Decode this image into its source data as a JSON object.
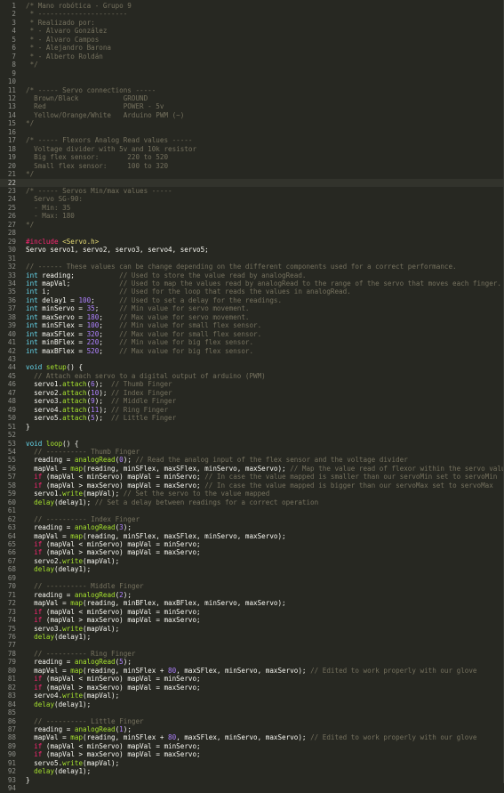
{
  "editor": {
    "current_line": 22,
    "lines": [
      [
        [
          "c",
          "/* Mano robótica - Grupo 9"
        ]
      ],
      [
        [
          "c",
          " * ----------------------"
        ]
      ],
      [
        [
          "c",
          " * Realizado por:"
        ]
      ],
      [
        [
          "c",
          " * - Álvaro González"
        ]
      ],
      [
        [
          "c",
          " * - Álvaro Campos"
        ]
      ],
      [
        [
          "c",
          " * - Alejandro Barona"
        ]
      ],
      [
        [
          "c",
          " * - Alberto Roldán"
        ]
      ],
      [
        [
          "c",
          " */"
        ]
      ],
      [],
      [],
      [
        [
          "c",
          "/* ----- Servo connections -----"
        ]
      ],
      [
        [
          "c",
          "  Brown/Black           GROUND"
        ]
      ],
      [
        [
          "c",
          "  Red                   POWER - 5v"
        ]
      ],
      [
        [
          "c",
          "  Yellow/Orange/White   Arduino PWM (~)"
        ]
      ],
      [
        [
          "c",
          "*/"
        ]
      ],
      [],
      [
        [
          "c",
          "/* ----- Flexors Analog Read values -----"
        ]
      ],
      [
        [
          "c",
          "  Voltage divider with 5v and 10k resistor"
        ]
      ],
      [
        [
          "c",
          "  Big flex sensor:       220 to 520"
        ]
      ],
      [
        [
          "c",
          "  Small flex sensor:     100 to 320"
        ]
      ],
      [
        [
          "c",
          "*/"
        ]
      ],
      [],
      [
        [
          "c",
          "/* ----- Servos Min/max values -----"
        ]
      ],
      [
        [
          "c",
          "  Servo SG-90:"
        ]
      ],
      [
        [
          "c",
          "  - Min: 35"
        ]
      ],
      [
        [
          "c",
          "  - Max: 180"
        ]
      ],
      [
        [
          "c",
          "*/"
        ]
      ],
      [],
      [
        [
          "k",
          "#include "
        ],
        [
          "s",
          "<Servo.h>"
        ]
      ],
      [
        [
          "p",
          "Servo servo1, servo2, servo3, servo4, servo5;"
        ]
      ],
      [],
      [
        [
          "c",
          "// ------ These values can be change depending on the different components used for a correct performance."
        ]
      ],
      [
        [
          "t",
          "int"
        ],
        [
          "p",
          " reading;           "
        ],
        [
          "c",
          "// Used to store the value read by analogRead."
        ]
      ],
      [
        [
          "t",
          "int"
        ],
        [
          "p",
          " mapVal;            "
        ],
        [
          "c",
          "// Used to map the values read by analogRead to the range of the servo that moves each finger."
        ]
      ],
      [
        [
          "t",
          "int"
        ],
        [
          "p",
          " i;                 "
        ],
        [
          "c",
          "// Used for the loop that reads the values in analogRead."
        ]
      ],
      [
        [
          "t",
          "int"
        ],
        [
          "p",
          " delay1 = "
        ],
        [
          "n",
          "100"
        ],
        [
          "p",
          ";      "
        ],
        [
          "c",
          "// Used to set a delay for the readings."
        ]
      ],
      [
        [
          "t",
          "int"
        ],
        [
          "p",
          " minServo = "
        ],
        [
          "n",
          "35"
        ],
        [
          "p",
          ";     "
        ],
        [
          "c",
          "// Min value for servo movement."
        ]
      ],
      [
        [
          "t",
          "int"
        ],
        [
          "p",
          " maxServo = "
        ],
        [
          "n",
          "180"
        ],
        [
          "p",
          ";    "
        ],
        [
          "c",
          "// Max value for servo movement."
        ]
      ],
      [
        [
          "t",
          "int"
        ],
        [
          "p",
          " minSFlex = "
        ],
        [
          "n",
          "100"
        ],
        [
          "p",
          ";    "
        ],
        [
          "c",
          "// Min value for small flex sensor."
        ]
      ],
      [
        [
          "t",
          "int"
        ],
        [
          "p",
          " maxSFlex = "
        ],
        [
          "n",
          "320"
        ],
        [
          "p",
          ";    "
        ],
        [
          "c",
          "// Max value for small flex sensor."
        ]
      ],
      [
        [
          "t",
          "int"
        ],
        [
          "p",
          " minBFlex = "
        ],
        [
          "n",
          "220"
        ],
        [
          "p",
          ";    "
        ],
        [
          "c",
          "// Min value for big flex sensor."
        ]
      ],
      [
        [
          "t",
          "int"
        ],
        [
          "p",
          " maxBFlex = "
        ],
        [
          "n",
          "520"
        ],
        [
          "p",
          ";    "
        ],
        [
          "c",
          "// Max value for big flex sensor."
        ]
      ],
      [],
      [
        [
          "t",
          "void"
        ],
        [
          "p",
          " "
        ],
        [
          "f",
          "setup"
        ],
        [
          "p",
          "() {"
        ]
      ],
      [
        [
          "c",
          "  // Attach each servo to a digital output of arduino (PWM)"
        ]
      ],
      [
        [
          "p",
          "  servo1."
        ],
        [
          "f",
          "attach"
        ],
        [
          "p",
          "("
        ],
        [
          "n",
          "6"
        ],
        [
          "p",
          ");  "
        ],
        [
          "c",
          "// Thumb Finger"
        ]
      ],
      [
        [
          "p",
          "  servo2."
        ],
        [
          "f",
          "attach"
        ],
        [
          "p",
          "("
        ],
        [
          "n",
          "10"
        ],
        [
          "p",
          "); "
        ],
        [
          "c",
          "// Index Finger"
        ]
      ],
      [
        [
          "p",
          "  servo3."
        ],
        [
          "f",
          "attach"
        ],
        [
          "p",
          "("
        ],
        [
          "n",
          "9"
        ],
        [
          "p",
          ");  "
        ],
        [
          "c",
          "// Middle Finger"
        ]
      ],
      [
        [
          "p",
          "  servo4."
        ],
        [
          "f",
          "attach"
        ],
        [
          "p",
          "("
        ],
        [
          "n",
          "11"
        ],
        [
          "p",
          "); "
        ],
        [
          "c",
          "// Ring Finger"
        ]
      ],
      [
        [
          "p",
          "  servo5."
        ],
        [
          "f",
          "attach"
        ],
        [
          "p",
          "("
        ],
        [
          "n",
          "5"
        ],
        [
          "p",
          ");  "
        ],
        [
          "c",
          "// Little Finger"
        ]
      ],
      [
        [
          "p",
          "}"
        ]
      ],
      [],
      [
        [
          "t",
          "void"
        ],
        [
          "p",
          " "
        ],
        [
          "f",
          "loop"
        ],
        [
          "p",
          "() {"
        ]
      ],
      [
        [
          "c",
          "  // ---------- Thumb Finger"
        ]
      ],
      [
        [
          "p",
          "  reading = "
        ],
        [
          "f",
          "analogRead"
        ],
        [
          "p",
          "("
        ],
        [
          "n",
          "0"
        ],
        [
          "p",
          "); "
        ],
        [
          "c",
          "// Read the analog input of the flex sensor and the voltage divider"
        ]
      ],
      [
        [
          "p",
          "  mapVal = "
        ],
        [
          "f",
          "map"
        ],
        [
          "p",
          "(reading, minSFlex, maxSFlex, minServo, maxServo); "
        ],
        [
          "c",
          "// Map the value read of flexor within the servo values"
        ]
      ],
      [
        [
          "p",
          "  "
        ],
        [
          "k",
          "if"
        ],
        [
          "p",
          " (mapVal < minServo) mapVal = minServo; "
        ],
        [
          "c",
          "// In case the value mapped is smaller than our servoMin set to servoMin"
        ]
      ],
      [
        [
          "p",
          "  "
        ],
        [
          "k",
          "if"
        ],
        [
          "p",
          " (mapVal > maxServo) mapVal = maxServo; "
        ],
        [
          "c",
          "// In case the value mapped is bigger than our servoMax set to servoMax"
        ]
      ],
      [
        [
          "p",
          "  servo1."
        ],
        [
          "f",
          "write"
        ],
        [
          "p",
          "(mapVal); "
        ],
        [
          "c",
          "// Set the servo to the value mapped"
        ]
      ],
      [
        [
          "p",
          "  "
        ],
        [
          "f",
          "delay"
        ],
        [
          "p",
          "(delay1); "
        ],
        [
          "c",
          "// Set a delay between readings for a correct operation"
        ]
      ],
      [],
      [
        [
          "c",
          "  // ---------- Index Finger"
        ]
      ],
      [
        [
          "p",
          "  reading = "
        ],
        [
          "f",
          "analogRead"
        ],
        [
          "p",
          "("
        ],
        [
          "n",
          "3"
        ],
        [
          "p",
          ");"
        ]
      ],
      [
        [
          "p",
          "  mapVal = "
        ],
        [
          "f",
          "map"
        ],
        [
          "p",
          "(reading, minSFlex, maxSFlex, minServo, maxServo);"
        ]
      ],
      [
        [
          "p",
          "  "
        ],
        [
          "k",
          "if"
        ],
        [
          "p",
          " (mapVal < minServo) mapVal = minServo;"
        ]
      ],
      [
        [
          "p",
          "  "
        ],
        [
          "k",
          "if"
        ],
        [
          "p",
          " (mapVal > maxServo) mapVal = maxServo;"
        ]
      ],
      [
        [
          "p",
          "  servo2."
        ],
        [
          "f",
          "write"
        ],
        [
          "p",
          "(mapVal);"
        ]
      ],
      [
        [
          "p",
          "  "
        ],
        [
          "f",
          "delay"
        ],
        [
          "p",
          "(delay1);"
        ]
      ],
      [],
      [
        [
          "c",
          "  // ---------- Middle Finger"
        ]
      ],
      [
        [
          "p",
          "  reading = "
        ],
        [
          "f",
          "analogRead"
        ],
        [
          "p",
          "("
        ],
        [
          "n",
          "2"
        ],
        [
          "p",
          ");"
        ]
      ],
      [
        [
          "p",
          "  mapVal = "
        ],
        [
          "f",
          "map"
        ],
        [
          "p",
          "(reading, minBFlex, maxBFlex, minServo, maxServo);"
        ]
      ],
      [
        [
          "p",
          "  "
        ],
        [
          "k",
          "if"
        ],
        [
          "p",
          " (mapVal < minServo) mapVal = minServo;"
        ]
      ],
      [
        [
          "p",
          "  "
        ],
        [
          "k",
          "if"
        ],
        [
          "p",
          " (mapVal > maxServo) mapVal = maxServo;"
        ]
      ],
      [
        [
          "p",
          "  servo3."
        ],
        [
          "f",
          "write"
        ],
        [
          "p",
          "(mapVal);"
        ]
      ],
      [
        [
          "p",
          "  "
        ],
        [
          "f",
          "delay"
        ],
        [
          "p",
          "(delay1);"
        ]
      ],
      [],
      [
        [
          "c",
          "  // ---------- Ring Finger"
        ]
      ],
      [
        [
          "p",
          "  reading = "
        ],
        [
          "f",
          "analogRead"
        ],
        [
          "p",
          "("
        ],
        [
          "n",
          "5"
        ],
        [
          "p",
          ");"
        ]
      ],
      [
        [
          "p",
          "  mapVal = "
        ],
        [
          "f",
          "map"
        ],
        [
          "p",
          "(reading, minSFlex + "
        ],
        [
          "n",
          "80"
        ],
        [
          "p",
          ", maxSFlex, minServo, maxServo); "
        ],
        [
          "c",
          "// Edited to work properly with our glove"
        ]
      ],
      [
        [
          "p",
          "  "
        ],
        [
          "k",
          "if"
        ],
        [
          "p",
          " (mapVal < minServo) mapVal = minServo;"
        ]
      ],
      [
        [
          "p",
          "  "
        ],
        [
          "k",
          "if"
        ],
        [
          "p",
          " (mapVal > maxServo) mapVal = maxServo;"
        ]
      ],
      [
        [
          "p",
          "  servo4."
        ],
        [
          "f",
          "write"
        ],
        [
          "p",
          "(mapVal);"
        ]
      ],
      [
        [
          "p",
          "  "
        ],
        [
          "f",
          "delay"
        ],
        [
          "p",
          "(delay1);"
        ]
      ],
      [],
      [
        [
          "c",
          "  // ---------- Little Finger"
        ]
      ],
      [
        [
          "p",
          "  reading = "
        ],
        [
          "f",
          "analogRead"
        ],
        [
          "p",
          "("
        ],
        [
          "n",
          "1"
        ],
        [
          "p",
          ");"
        ]
      ],
      [
        [
          "p",
          "  mapVal = "
        ],
        [
          "f",
          "map"
        ],
        [
          "p",
          "(reading, minSFlex + "
        ],
        [
          "n",
          "80"
        ],
        [
          "p",
          ", maxSFlex, minServo, maxServo); "
        ],
        [
          "c",
          "// Edited to work properly with our glove"
        ]
      ],
      [
        [
          "p",
          "  "
        ],
        [
          "k",
          "if"
        ],
        [
          "p",
          " (mapVal < minServo) mapVal = minServo;"
        ]
      ],
      [
        [
          "p",
          "  "
        ],
        [
          "k",
          "if"
        ],
        [
          "p",
          " (mapVal > maxServo) mapVal = maxServo;"
        ]
      ],
      [
        [
          "p",
          "  servo5."
        ],
        [
          "f",
          "write"
        ],
        [
          "p",
          "(mapVal);"
        ]
      ],
      [
        [
          "p",
          "  "
        ],
        [
          "f",
          "delay"
        ],
        [
          "p",
          "(delay1);"
        ]
      ],
      [
        [
          "p",
          "}"
        ]
      ],
      []
    ]
  },
  "colors": {
    "background": "#272822",
    "comment": "#75715e",
    "keyword": "#f92672",
    "type": "#66d9ef",
    "number": "#ae81ff",
    "function": "#a6e22e",
    "string": "#e6db74",
    "plain": "#f8f8f2"
  }
}
